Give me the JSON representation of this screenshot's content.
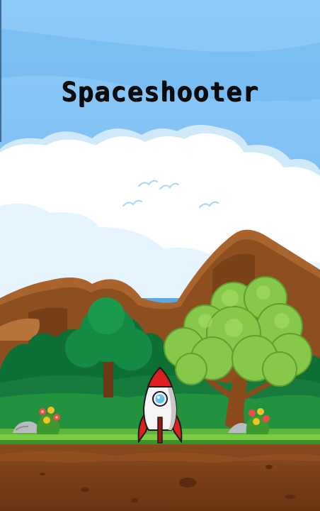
{
  "game": {
    "title": "Spaceshooter"
  },
  "colors": {
    "sky_top": "#8fcaf8",
    "sky_mid": "#57a7e3",
    "cloud": "#ffffff",
    "cloud_shade": "#cfeaf9",
    "mountain": "#a8642c",
    "mountain_dark": "#7a4518",
    "forest_dark": "#0e6f35",
    "forest_mid": "#1e8f45",
    "tree_canopy": "#86c84a",
    "tree_trunk": "#8a4a1c",
    "grass": "#5fb739",
    "dirt": "#7a3e19",
    "rocket_body": "#f4f4f4",
    "rocket_red": "#dd1f1f"
  },
  "sprites": {
    "player": "rocket-ship",
    "decor": [
      "cloud",
      "bird",
      "mountain",
      "tree",
      "flower-bush",
      "rock"
    ]
  }
}
